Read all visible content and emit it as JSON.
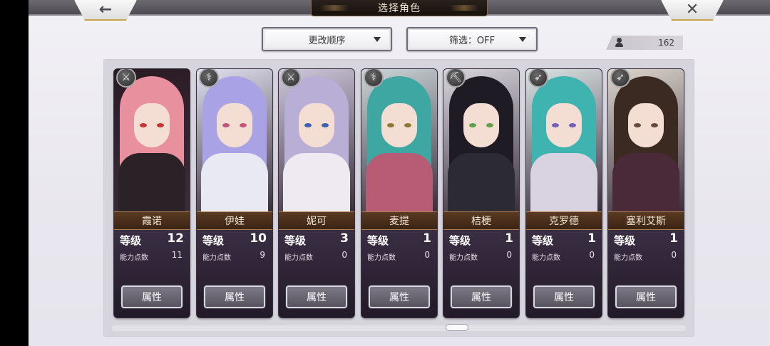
{
  "header": {
    "title": "选择角色",
    "back_icon": "←",
    "close_icon": "✕"
  },
  "toolbar": {
    "sort_label": "更改顺序",
    "filter_label": "筛选：OFF",
    "character_count": "162"
  },
  "labels": {
    "level": "等级",
    "ability_points": "能力点数",
    "attributes_button": "属性"
  },
  "characters": [
    {
      "name": "霞诺",
      "level": "12",
      "ability_points": "11",
      "weapon": "sword-icon",
      "weapon_glyph": "⚔",
      "hair": "#e8909e",
      "bg": "#2a1a22",
      "body": "#2a2226",
      "eye": "#c33"
    },
    {
      "name": "伊娃",
      "level": "10",
      "ability_points": "9",
      "weapon": "staff-icon",
      "weapon_glyph": "⚕",
      "hair": "#a9a3e6",
      "bg": "#dfe0ee",
      "body": "#e8e9f2",
      "eye": "#c3557c"
    },
    {
      "name": "妮可",
      "level": "3",
      "ability_points": "0",
      "weapon": "sword-icon",
      "weapon_glyph": "⚔",
      "hair": "#b8aed6",
      "bg": "#cfc8dc",
      "body": "#efe9f1",
      "eye": "#3c5fb3"
    },
    {
      "name": "麦提",
      "level": "1",
      "ability_points": "0",
      "weapon": "staff-icon",
      "weapon_glyph": "⚕",
      "hair": "#3fa7a2",
      "bg": "#cbd6d8",
      "body": "#b75c74",
      "eye": "#8d7a32"
    },
    {
      "name": "桔梗",
      "level": "1",
      "ability_points": "0",
      "weapon": "axe-icon",
      "weapon_glyph": "⛏",
      "hair": "#1e1b25",
      "bg": "#d9d7de",
      "body": "#2c2b33",
      "eye": "#5aa24b"
    },
    {
      "name": "克罗德",
      "level": "1",
      "ability_points": "0",
      "weapon": "bow-icon",
      "weapon_glyph": "➶",
      "hair": "#3fb3b0",
      "bg": "#dbe4e4",
      "body": "#d9d2e0",
      "eye": "#6f5fb8"
    },
    {
      "name": "塞利艾斯",
      "level": "1",
      "ability_points": "0",
      "weapon": "bow-icon",
      "weapon_glyph": "➶",
      "hair": "#3b2a22",
      "bg": "#ddd6cc",
      "body": "#4a2a38",
      "eye": "#6b4a3a"
    }
  ]
}
